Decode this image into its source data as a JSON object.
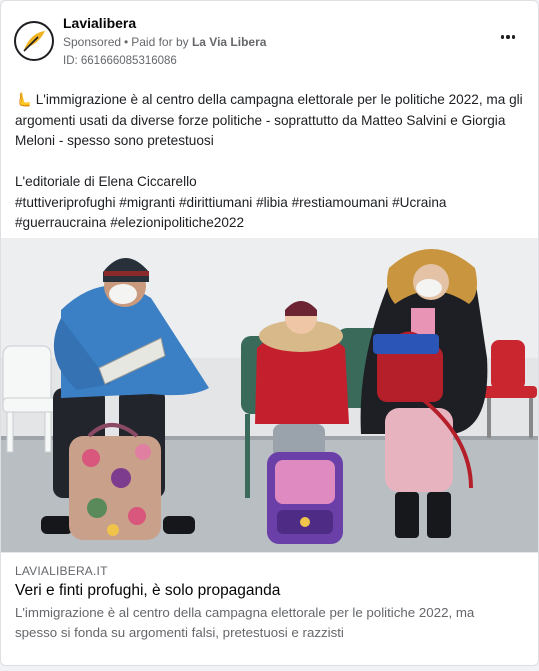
{
  "post": {
    "page_name": "Lavialibera",
    "sponsored_label": "Sponsored",
    "separator": "•",
    "paid_for_prefix": "Paid for by",
    "paid_for_name": "La Via Libera",
    "ad_id": "ID: 661666085316086",
    "more_icon": "more-horizontal-icon",
    "avatar_icon": "quill-feather-logo"
  },
  "body": {
    "emoji": "🫷",
    "line1": "L'immigrazione è al centro della campagna elettorale per le politiche 2022, ma gli argomenti usati da diverse forze politiche - soprattutto da Matteo Salvini e Giorgia Meloni - spesso sono pretestuosi",
    "line2": "L'editoriale di Elena Ciccarello",
    "hashtags": [
      "#tuttiveriprofughi",
      "#migranti",
      "#dirittiumani",
      "#libia",
      "#restiamoumani",
      "#Ucraina",
      "#guerraucraina",
      "#elezionipolitiche2022"
    ]
  },
  "link_preview": {
    "domain": "LAVIALIBERA.IT",
    "title": "Veri e finti profughi, è solo propaganda",
    "description": "L'immigrazione è al centro della campagna elettorale per le politiche 2022, ma spesso si fonda su argomenti falsi, pretestuosi e razzisti"
  },
  "colors": {
    "card_bg": "#ffffff",
    "page_bg": "#f0f2f5",
    "text_primary": "#050505",
    "text_secondary": "#65676b",
    "avatar_accent": "#f0b322"
  }
}
